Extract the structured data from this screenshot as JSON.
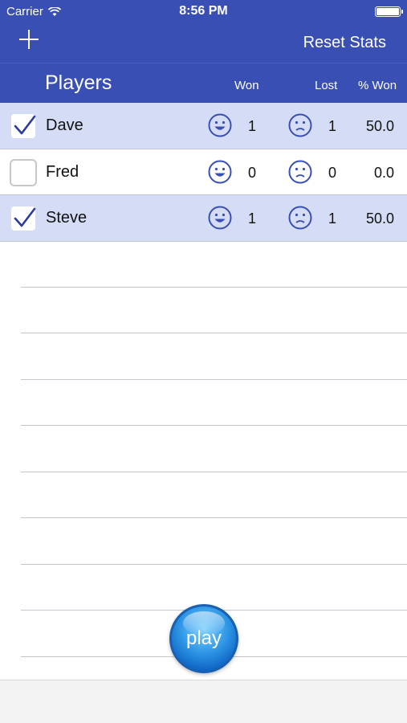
{
  "status_bar": {
    "carrier": "Carrier",
    "time": "8:56 PM"
  },
  "nav": {
    "add_icon": "plus-icon",
    "reset_label": "Reset Stats"
  },
  "header": {
    "title": "Players",
    "won": "Won",
    "lost": "Lost",
    "pct_won": "% Won"
  },
  "players": [
    {
      "name": "Dave",
      "selected": true,
      "won": "1",
      "lost": "1",
      "pct": "50.0"
    },
    {
      "name": "Fred",
      "selected": false,
      "won": "0",
      "lost": "0",
      "pct": "0.0"
    },
    {
      "name": "Steve",
      "selected": true,
      "won": "1",
      "lost": "1",
      "pct": "50.0"
    }
  ],
  "play_button": {
    "label": "play"
  },
  "colors": {
    "accent": "#3a4fb3",
    "selected_row": "#d5ddf6",
    "play": "#2f97e6"
  },
  "icons": {
    "won": "happy-face-icon",
    "lost": "sad-face-icon",
    "check": "checkmark-icon"
  }
}
